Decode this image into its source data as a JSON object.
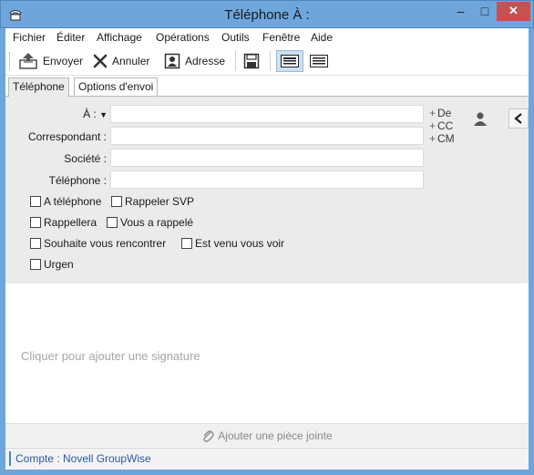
{
  "window": {
    "title": "Téléphone À :",
    "minimize_glyph": "–",
    "maximize_glyph": "□",
    "close_glyph": "✕"
  },
  "menu": {
    "items": [
      "Fichier",
      "Éditer",
      "Affichage",
      "Opérations",
      "Outils",
      "Fenêtre",
      "Aide"
    ]
  },
  "toolbar": {
    "send_label": "Envoyer",
    "cancel_label": "Annuler",
    "address_label": "Adresse"
  },
  "tabs": [
    {
      "label": "Téléphone",
      "active": true
    },
    {
      "label": "Options d'envoi",
      "active": false
    }
  ],
  "form": {
    "to_label": "À :",
    "to_value": "",
    "correspondent_label": "Correspondant :",
    "correspondent_value": "",
    "company_label": "Société :",
    "company_value": "",
    "phone_label": "Téléphone :",
    "phone_value": "",
    "add_from": "De",
    "add_cc": "CC",
    "add_bc": "CM"
  },
  "checkboxes": [
    {
      "label": "A téléphone",
      "checked": false
    },
    {
      "label": "Rappeler SVP",
      "checked": false
    },
    {
      "label": "Rappellera",
      "checked": false
    },
    {
      "label": "Vous a rappelé",
      "checked": false
    },
    {
      "label": "Souhaite vous rencontrer",
      "checked": false
    },
    {
      "label": "Est venu vous voir",
      "checked": false
    },
    {
      "label": "Urgen",
      "checked": false
    }
  ],
  "body": {
    "signature_placeholder": "Cliquer pour ajouter une signature"
  },
  "attach": {
    "label": "Ajouter une pièce jointe"
  },
  "status": {
    "account": "Compte : Novell GroupWise"
  },
  "colors": {
    "titlebar": "#6ea6dc",
    "close_button": "#c75050",
    "header_bg": "#ebebeb",
    "status_text": "#2b5b9a"
  },
  "icons": [
    "phone-icon",
    "send-icon",
    "cancel-x-icon",
    "address-book-icon",
    "save-disk-icon",
    "view-normal-icon",
    "view-plain-icon",
    "person-icon",
    "chevron-left-icon",
    "paperclip-icon"
  ]
}
